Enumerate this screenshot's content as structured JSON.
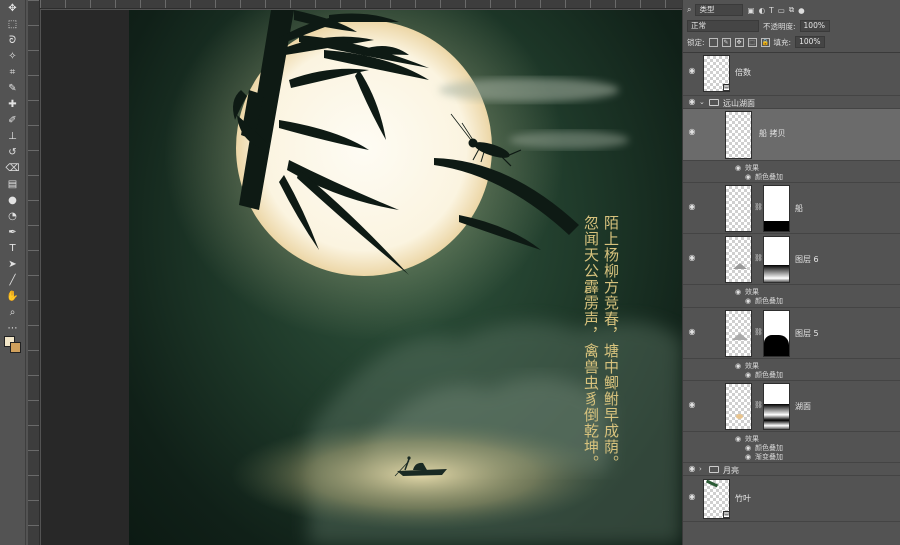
{
  "toolbar": {
    "tools": [
      "move-tool",
      "marquee-tool",
      "lasso-tool",
      "magic-wand-tool",
      "crop-tool",
      "eyedropper-tool",
      "healing-brush-tool",
      "brush-tool",
      "clone-stamp-tool",
      "history-brush-tool",
      "eraser-tool",
      "gradient-tool",
      "blur-tool",
      "dodge-tool",
      "pen-tool",
      "type-tool",
      "path-selection-tool",
      "line-tool",
      "hand-tool",
      "zoom-tool",
      "more-tools"
    ],
    "glyphs": [
      "✥",
      "⬚",
      "ᘐ",
      "✧",
      "⌗",
      "✎",
      "✚",
      "✐",
      "⊥",
      "↺",
      "⌫",
      "▤",
      "●",
      "◔",
      "✒",
      "T",
      "➤",
      "╱",
      "✋",
      "⌕",
      "⋯"
    ],
    "foreground_color": "#f2e6c8",
    "background_color": "#d0a05c"
  },
  "panel": {
    "filter_label": "类型",
    "blend_mode": "正常",
    "opacity_label": "不透明度:",
    "opacity_value": "100%",
    "lock_label": "锁定:",
    "fill_label": "填充:",
    "fill_value": "100%"
  },
  "layers": [
    {
      "name": "倍数",
      "type": "layer"
    },
    {
      "name": "远山湖面",
      "type": "group"
    },
    {
      "name": "船 拷贝",
      "type": "layer",
      "selected": true,
      "effects": [
        "效果",
        "颜色叠加"
      ]
    },
    {
      "name": "船",
      "type": "masked"
    },
    {
      "name": "图层 6",
      "type": "masked",
      "effects": [
        "效果",
        "颜色叠加"
      ]
    },
    {
      "name": "图层 5",
      "type": "masked",
      "effects": [
        "效果",
        "颜色叠加"
      ]
    },
    {
      "name": "湖面",
      "type": "masked",
      "effects": [
        "效果",
        "颜色叠加",
        "渐变叠加"
      ]
    },
    {
      "name": "月亮",
      "type": "group"
    },
    {
      "name": "竹叶",
      "type": "layer"
    }
  ],
  "artwork": {
    "poem_columns": [
      "陌上杨柳方竞春，塘中鲫鲋早成荫。",
      "忽闻天公霹雳声，禽兽虫豸倒乾坤。"
    ],
    "moon_color": "#fbf6e8",
    "bg_color": "#1f3a2a",
    "text_color": "#d7c27d"
  }
}
